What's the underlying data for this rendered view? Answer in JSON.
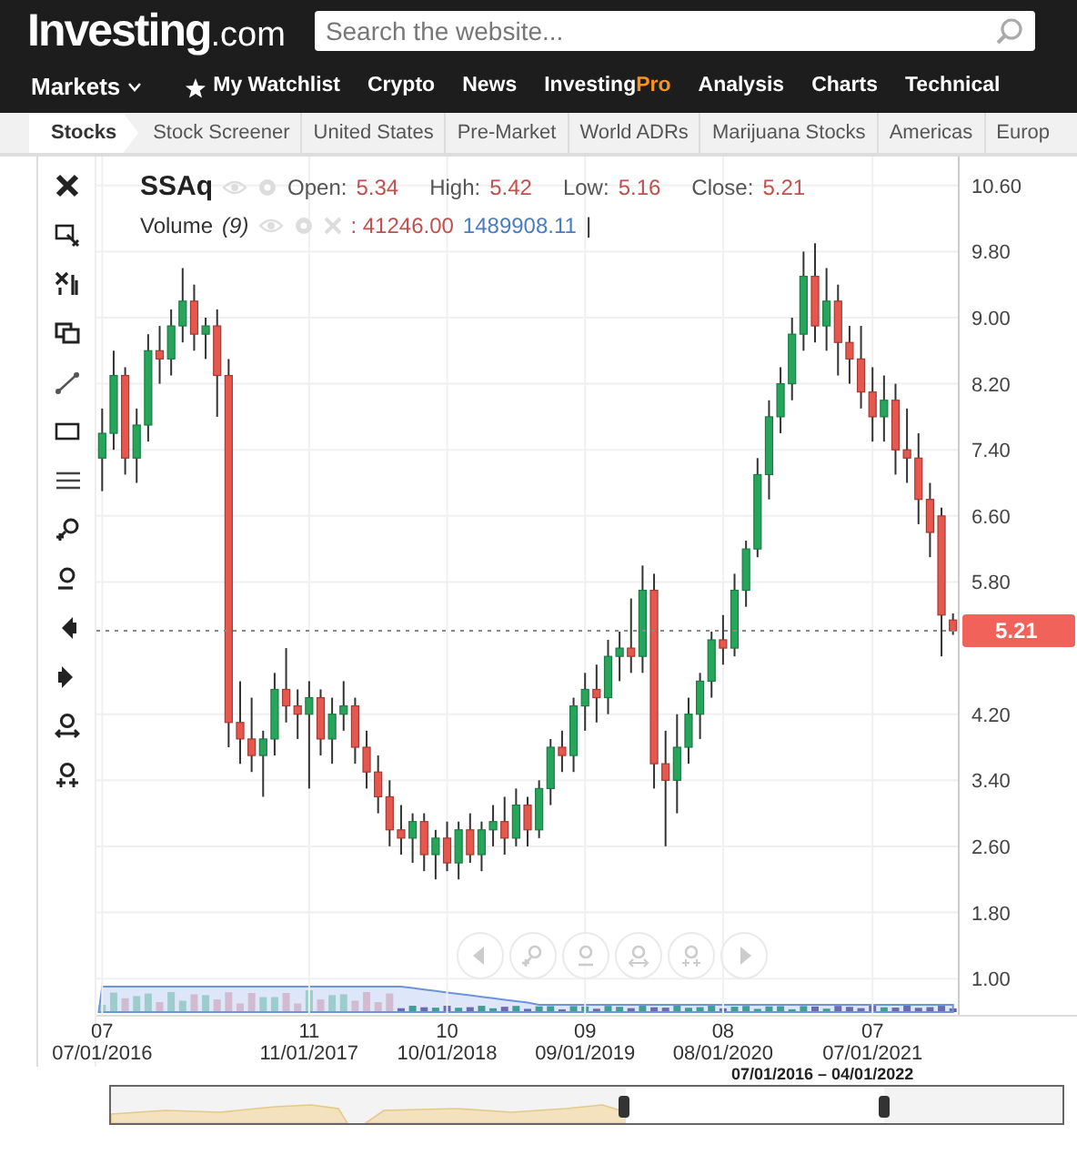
{
  "header": {
    "logo": {
      "brand": "Investing",
      "suffix": ".com"
    },
    "search": {
      "placeholder": "Search the website..."
    }
  },
  "nav": [
    {
      "label": "Markets",
      "kind": "dropdown"
    },
    {
      "label": "My Watchlist",
      "kind": "starred"
    },
    {
      "label": "Crypto",
      "kind": "link"
    },
    {
      "label": "News",
      "kind": "link"
    },
    {
      "label": "Investing",
      "accent": "Pro",
      "kind": "brand"
    },
    {
      "label": "Analysis",
      "kind": "link"
    },
    {
      "label": "Charts",
      "kind": "link"
    },
    {
      "label": "Technical",
      "kind": "link"
    }
  ],
  "subnav": [
    {
      "label": "Stocks",
      "selected": true
    },
    {
      "label": "Stock Screener",
      "selected": false
    },
    {
      "label": "United States",
      "selected": false
    },
    {
      "label": "Pre-Market",
      "selected": false
    },
    {
      "label": "World ADRs",
      "selected": false
    },
    {
      "label": "Marijuana Stocks",
      "selected": false
    },
    {
      "label": "Americas",
      "selected": false
    },
    {
      "label": "Europ",
      "selected": false
    }
  ],
  "chart": {
    "symbol": "SSAq",
    "ohlc": [
      {
        "label": "Open:",
        "value": "5.34"
      },
      {
        "label": "High:",
        "value": "5.42"
      },
      {
        "label": "Low:",
        "value": "5.16"
      },
      {
        "label": "Close:",
        "value": "5.21"
      }
    ],
    "volume": {
      "label": "Volume",
      "period": "(9)",
      "values": [
        {
          "text": ": 41246.00",
          "color": "#c0504d"
        },
        {
          "text": "1489908.11",
          "color": "#4a7cc4"
        }
      ],
      "end_mark": "|"
    },
    "last_price": "5.21",
    "x_axis_months": [
      "07",
      "11",
      "10",
      "09",
      "08",
      "07"
    ],
    "chart_data": {
      "type": "candlestick",
      "ylim": [
        0.55,
        10.95
      ],
      "grid": true,
      "yticks": [
        {
          "value": 10.6,
          "label": "10.60"
        },
        {
          "value": 9.8,
          "label": "9.80"
        },
        {
          "value": 9.0,
          "label": "9.00"
        },
        {
          "value": 8.2,
          "label": "8.20"
        },
        {
          "value": 7.4,
          "label": "7.40"
        },
        {
          "value": 6.6,
          "label": "6.60"
        },
        {
          "value": 5.8,
          "label": "5.80"
        },
        {
          "value": 4.2,
          "label": "4.20"
        },
        {
          "value": 3.4,
          "label": "3.40"
        },
        {
          "value": 2.6,
          "label": "2.60"
        },
        {
          "value": 1.8,
          "label": "1.80"
        },
        {
          "value": 1.0,
          "label": "1.00"
        }
      ],
      "categories": [
        "07/01/2016",
        null,
        null,
        null,
        null,
        null,
        null,
        null,
        null,
        null,
        null,
        null,
        null,
        null,
        null,
        null,
        null,
        null,
        "11/01/2017",
        null,
        null,
        null,
        null,
        null,
        null,
        null,
        null,
        null,
        null,
        null,
        "10/01/2018",
        null,
        null,
        null,
        null,
        null,
        null,
        null,
        null,
        null,
        null,
        null,
        "09/01/2019",
        null,
        null,
        null,
        null,
        null,
        null,
        null,
        null,
        null,
        null,
        null,
        "08/01/2020",
        null,
        null,
        null,
        null,
        null,
        null,
        null,
        null,
        null,
        null,
        null,
        null,
        "07/01/2021",
        null,
        null,
        null,
        null,
        null,
        null,
        null
      ],
      "ohlc": [
        [
          7.3,
          7.9,
          6.9,
          7.6
        ],
        [
          7.6,
          8.6,
          7.4,
          8.3
        ],
        [
          8.3,
          8.4,
          7.1,
          7.3
        ],
        [
          7.3,
          7.9,
          7.0,
          7.7
        ],
        [
          7.7,
          8.8,
          7.5,
          8.6
        ],
        [
          8.6,
          8.9,
          8.2,
          8.5
        ],
        [
          8.5,
          9.1,
          8.3,
          8.9
        ],
        [
          8.9,
          9.6,
          8.7,
          9.2
        ],
        [
          9.2,
          9.4,
          8.6,
          8.8
        ],
        [
          8.8,
          9.0,
          8.5,
          8.9
        ],
        [
          8.9,
          9.1,
          7.8,
          8.3
        ],
        [
          8.3,
          8.5,
          3.8,
          4.1
        ],
        [
          4.1,
          4.6,
          3.6,
          3.9
        ],
        [
          3.9,
          4.4,
          3.5,
          3.7
        ],
        [
          3.7,
          4.0,
          3.2,
          3.9
        ],
        [
          3.9,
          4.7,
          3.7,
          4.5
        ],
        [
          4.5,
          5.0,
          4.1,
          4.3
        ],
        [
          4.3,
          4.5,
          3.9,
          4.2
        ],
        [
          4.2,
          4.6,
          3.3,
          4.4
        ],
        [
          4.4,
          4.5,
          3.7,
          3.9
        ],
        [
          3.9,
          4.4,
          3.6,
          4.2
        ],
        [
          4.2,
          4.6,
          4.0,
          4.3
        ],
        [
          4.3,
          4.4,
          3.6,
          3.8
        ],
        [
          3.8,
          4.0,
          3.3,
          3.5
        ],
        [
          3.5,
          3.7,
          3.0,
          3.2
        ],
        [
          3.2,
          3.4,
          2.6,
          2.8
        ],
        [
          2.8,
          3.1,
          2.5,
          2.7
        ],
        [
          2.7,
          3.0,
          2.4,
          2.9
        ],
        [
          2.9,
          3.0,
          2.3,
          2.5
        ],
        [
          2.5,
          2.8,
          2.2,
          2.7
        ],
        [
          2.7,
          2.9,
          2.3,
          2.4
        ],
        [
          2.4,
          2.9,
          2.2,
          2.8
        ],
        [
          2.8,
          3.0,
          2.4,
          2.5
        ],
        [
          2.5,
          2.9,
          2.3,
          2.8
        ],
        [
          2.8,
          3.1,
          2.6,
          2.9
        ],
        [
          2.9,
          3.2,
          2.5,
          2.7
        ],
        [
          2.7,
          3.3,
          2.6,
          3.1
        ],
        [
          3.1,
          3.2,
          2.6,
          2.8
        ],
        [
          2.8,
          3.4,
          2.7,
          3.3
        ],
        [
          3.3,
          3.9,
          3.1,
          3.8
        ],
        [
          3.8,
          4.0,
          3.5,
          3.7
        ],
        [
          3.7,
          4.4,
          3.5,
          4.3
        ],
        [
          4.3,
          4.7,
          4.0,
          4.5
        ],
        [
          4.5,
          4.8,
          4.1,
          4.4
        ],
        [
          4.4,
          5.1,
          4.2,
          4.9
        ],
        [
          4.9,
          5.2,
          4.6,
          5.0
        ],
        [
          5.0,
          5.6,
          4.7,
          4.9
        ],
        [
          4.9,
          6.0,
          4.7,
          5.7
        ],
        [
          5.7,
          5.9,
          3.3,
          3.6
        ],
        [
          3.6,
          4.0,
          2.6,
          3.4
        ],
        [
          3.4,
          4.2,
          3.0,
          3.8
        ],
        [
          3.8,
          4.4,
          3.6,
          4.2
        ],
        [
          4.2,
          4.7,
          3.9,
          4.6
        ],
        [
          4.6,
          5.2,
          4.4,
          5.1
        ],
        [
          5.1,
          5.4,
          4.8,
          5.0
        ],
        [
          5.0,
          5.9,
          4.9,
          5.7
        ],
        [
          5.7,
          6.3,
          5.5,
          6.2
        ],
        [
          6.2,
          7.3,
          6.1,
          7.1
        ],
        [
          7.1,
          8.0,
          6.8,
          7.8
        ],
        [
          7.8,
          8.4,
          7.6,
          8.2
        ],
        [
          8.2,
          9.0,
          8.0,
          8.8
        ],
        [
          8.8,
          9.8,
          8.6,
          9.5
        ],
        [
          9.5,
          9.9,
          8.7,
          8.9
        ],
        [
          8.9,
          9.6,
          8.6,
          9.2
        ],
        [
          9.2,
          9.4,
          8.3,
          8.7
        ],
        [
          8.7,
          8.9,
          8.2,
          8.5
        ],
        [
          8.5,
          8.9,
          7.9,
          8.1
        ],
        [
          8.1,
          8.4,
          7.5,
          7.8
        ],
        [
          7.8,
          8.3,
          7.5,
          8.0
        ],
        [
          8.0,
          8.2,
          7.1,
          7.4
        ],
        [
          7.4,
          7.9,
          7.0,
          7.3
        ],
        [
          7.3,
          7.6,
          6.5,
          6.8
        ],
        [
          6.8,
          7.0,
          6.1,
          6.4
        ],
        [
          6.6,
          6.7,
          4.9,
          5.4
        ],
        [
          5.34,
          5.42,
          5.16,
          5.21
        ]
      ]
    }
  },
  "navigator": {
    "range": "07/01/2016 – 04/01/2022"
  }
}
